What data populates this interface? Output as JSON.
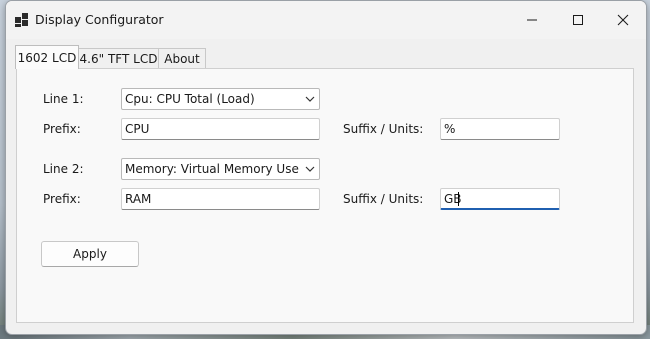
{
  "window": {
    "title": "Display Configurator",
    "app_icon": "windows-grid-icon",
    "controls": {
      "minimize": "—",
      "maximize": "☐",
      "close": "✕"
    }
  },
  "tabs": [
    {
      "label": "1602 LCD",
      "active": true
    },
    {
      "label": "4.6\" TFT LCD",
      "active": false
    },
    {
      "label": "About",
      "active": false
    }
  ],
  "line1": {
    "label": "Line 1:",
    "selected": "Cpu: CPU Total (Load)",
    "prefix_label": "Prefix:",
    "prefix_value": "CPU",
    "suffix_label": "Suffix / Units:",
    "suffix_value": "%"
  },
  "line2": {
    "label": "Line 2:",
    "selected": "Memory: Virtual Memory Used (D",
    "prefix_label": "Prefix:",
    "prefix_value": "RAM",
    "suffix_label": "Suffix / Units:",
    "suffix_value": "GB"
  },
  "apply_label": "Apply",
  "colors": {
    "focus_accent": "#1f5fb0",
    "window_bg": "#f0f0f0"
  }
}
